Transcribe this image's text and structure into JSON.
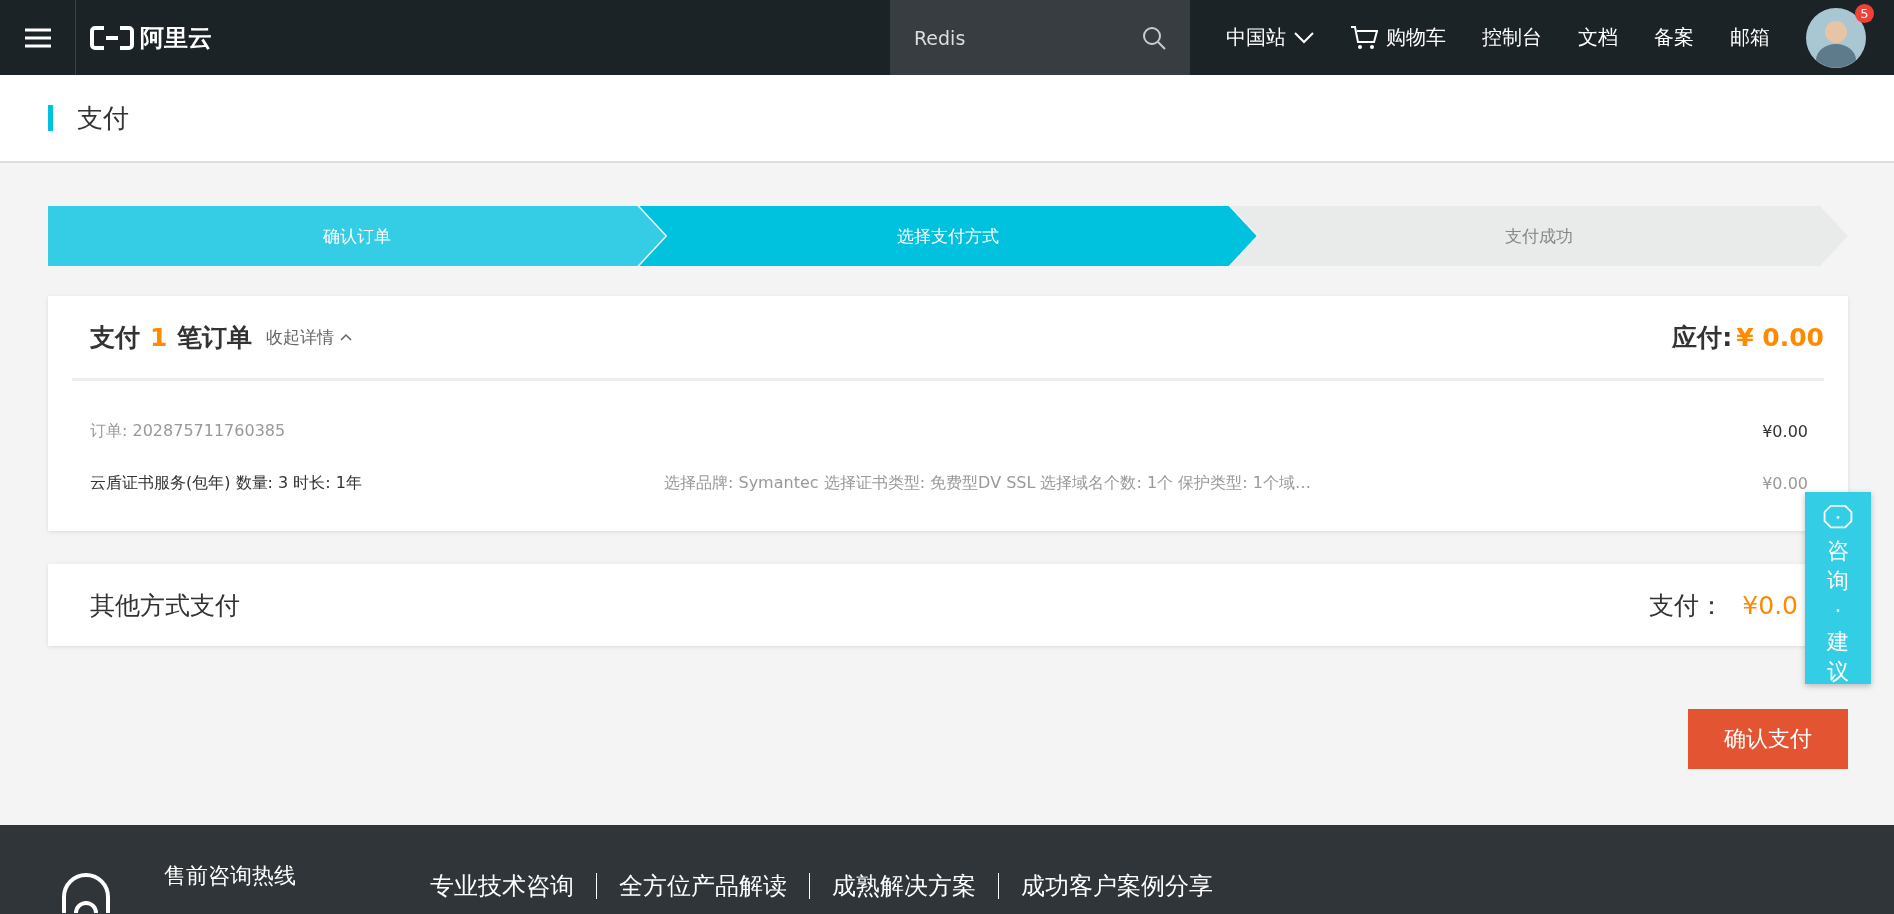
{
  "topbar": {
    "logo_text": "阿里云",
    "search": {
      "value": "Redis"
    },
    "site": "中国站",
    "cart": "购物车",
    "links": [
      "控制台",
      "文档",
      "备案",
      "邮箱"
    ],
    "badge": "5"
  },
  "page_title": "支付",
  "steps": [
    {
      "label": "确认订单",
      "done": true,
      "selected": false
    },
    {
      "label": "选择支付方式",
      "done": false,
      "selected": true
    },
    {
      "label": "支付成功",
      "done": false,
      "selected": false
    }
  ],
  "order": {
    "title_prefix": "支付",
    "count": "1",
    "title_suffix": "笔订单",
    "toggle": "收起详情",
    "expanded": true,
    "due_label": "应付:",
    "due_amount": "¥ 0.00",
    "order_no": "订单: 202875711760385",
    "order_price": "¥0.00",
    "items": [
      {
        "name": "云盾证书服务(包年) 数量: 3 时长: 1年",
        "spec": "选择品牌: Symantec 选择证书类型: 免费型DV SSL 选择域名个数: 1个 保护类型: 1个域…",
        "price": "¥0.00"
      }
    ]
  },
  "other_payment": {
    "title": "其他方式支付",
    "pay_label": "支付：",
    "pay_amount": "¥0.0"
  },
  "confirm_button": "确认支付",
  "consult_tab": [
    "咨",
    "询",
    "·",
    "建",
    "议"
  ],
  "footer": {
    "hotline": "售前咨询热线",
    "links": [
      "专业技术咨询",
      "全方位产品解读",
      "成熟解决方案",
      "成功客户案例分享"
    ]
  }
}
